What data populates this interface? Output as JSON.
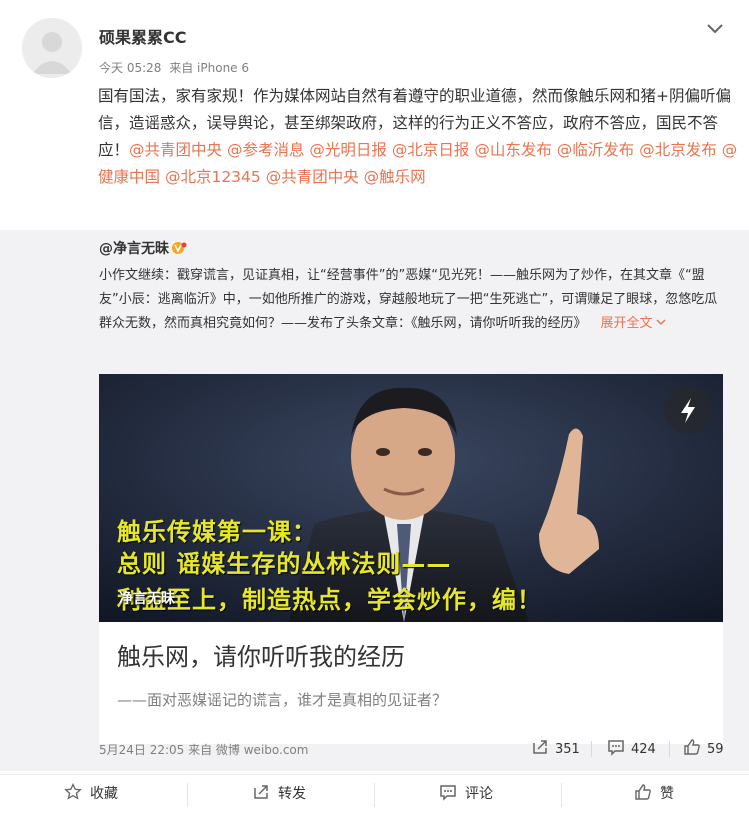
{
  "post": {
    "username": "硕果累累CC",
    "time": "今天 05:28",
    "source": "来自 iPhone 6",
    "text_intro": "国有国法，家有家规！作为媒体网站自然有着遵守的职业道德，然而像触乐网和猪+阴偏听偏信，造谣惑众，误导舆论，甚至绑架政府，这样的行为正义不答应，政府不答应，国民不答应！",
    "mentions": [
      "@共青团中央",
      "@参考消息",
      "@光明日报",
      "@北京日报",
      "@山东发布",
      "@临沂发布",
      "@北京发布",
      "@健康中国",
      "@北京12345",
      "@共青团中央",
      "@触乐网"
    ]
  },
  "repost": {
    "username": "@净言无昧",
    "text": "小作文继续：戳穿谎言，见证真相，让“经营事件”的”恶媒“见光死！——触乐网为了炒作，在其文章《“盟友”小辰：逃离临沂》中，一如他所推广的游戏，穿越般地玩了一把“生死逃亡”，可谓赚足了眼球，忽悠吃瓜群众无数，然而真相究竟如何？——发布了头条文章：《触乐网，请你听听我的经历》",
    "expand_label": "展开全文",
    "card": {
      "overlay_line1": "触乐传媒第一课：",
      "overlay_line2": "总则  谣媒生存的丛林法则——",
      "overlay_line3": "利益至上，制造热点，学会炒作，编！",
      "watermark": "净言无昧",
      "title": "触乐网，请你听听我的经历",
      "subtitle": "——面对恶媒谣记的谎言，谁才是真相的见证者？"
    },
    "meta": "5月24日 22:05 来自 微博 weibo.com",
    "reposts": "351",
    "comments": "424",
    "likes": "59"
  },
  "actions": {
    "favorite": "收藏",
    "repost": "转发",
    "comment": "评论",
    "like": "赞"
  },
  "colors": {
    "mention": "#eb7350",
    "overlay_text": "#e6e62a",
    "repost_bg": "#f2f2f5"
  },
  "icons": [
    "chevron-down-icon",
    "vip-badge-icon",
    "flash-icon",
    "repost-icon",
    "comment-icon",
    "like-icon",
    "star-icon"
  ]
}
